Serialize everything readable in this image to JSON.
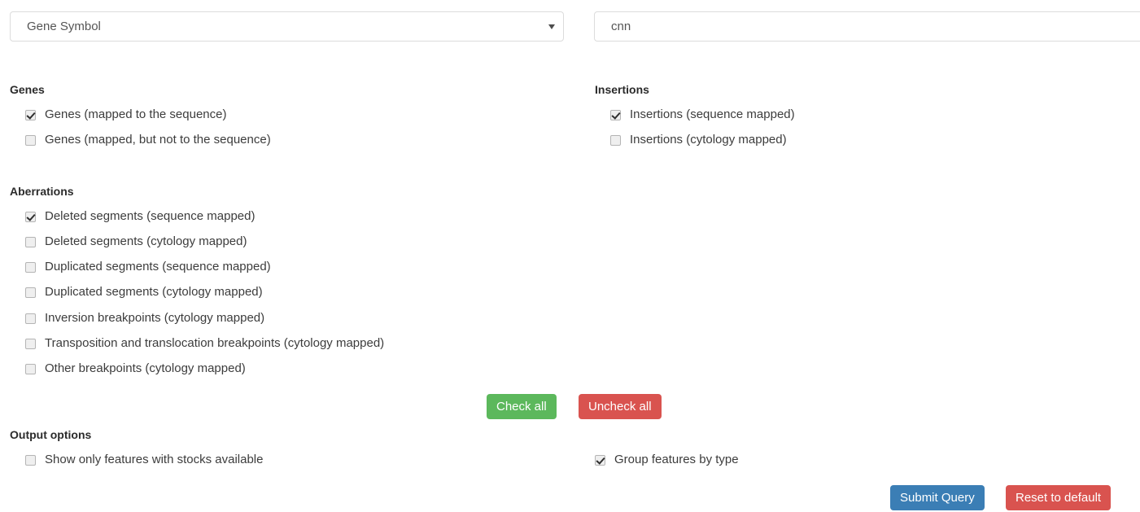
{
  "query": {
    "field_select": {
      "selected": "Gene Symbol",
      "options": [
        "Gene Symbol"
      ]
    },
    "search_input": {
      "value": "cnn",
      "placeholder": ""
    }
  },
  "sections": {
    "genes": {
      "title": "Genes",
      "items": [
        {
          "label": "Genes (mapped to the sequence)",
          "checked": true
        },
        {
          "label": "Genes (mapped, but not to the sequence)",
          "checked": false
        }
      ]
    },
    "insertions": {
      "title": "Insertions",
      "items": [
        {
          "label": "Insertions (sequence mapped)",
          "checked": true
        },
        {
          "label": "Insertions (cytology mapped)",
          "checked": false
        }
      ]
    },
    "aberrations": {
      "title": "Aberrations",
      "items": [
        {
          "label": "Deleted segments (sequence mapped)",
          "checked": true
        },
        {
          "label": "Deleted segments (cytology mapped)",
          "checked": false
        },
        {
          "label": "Duplicated segments (sequence mapped)",
          "checked": false
        },
        {
          "label": "Duplicated segments (cytology mapped)",
          "checked": false
        },
        {
          "label": "Inversion breakpoints (cytology mapped)",
          "checked": false
        },
        {
          "label": "Transposition and translocation breakpoints (cytology mapped)",
          "checked": false
        },
        {
          "label": "Other breakpoints (cytology mapped)",
          "checked": false
        }
      ]
    },
    "output_options": {
      "title": "Output options",
      "items": [
        {
          "label": "Show only features with stocks available",
          "checked": false
        },
        {
          "label": "Group features by type",
          "checked": true
        }
      ]
    }
  },
  "actions": {
    "check_all": "Check all",
    "uncheck_all": "Uncheck all",
    "submit": "Submit Query",
    "reset": "Reset to default"
  },
  "colors": {
    "success": "#5cb85c",
    "danger": "#d9534f",
    "primary": "#3b7eb5",
    "border": "#dcdcdc",
    "text": "#3c3c3c"
  }
}
